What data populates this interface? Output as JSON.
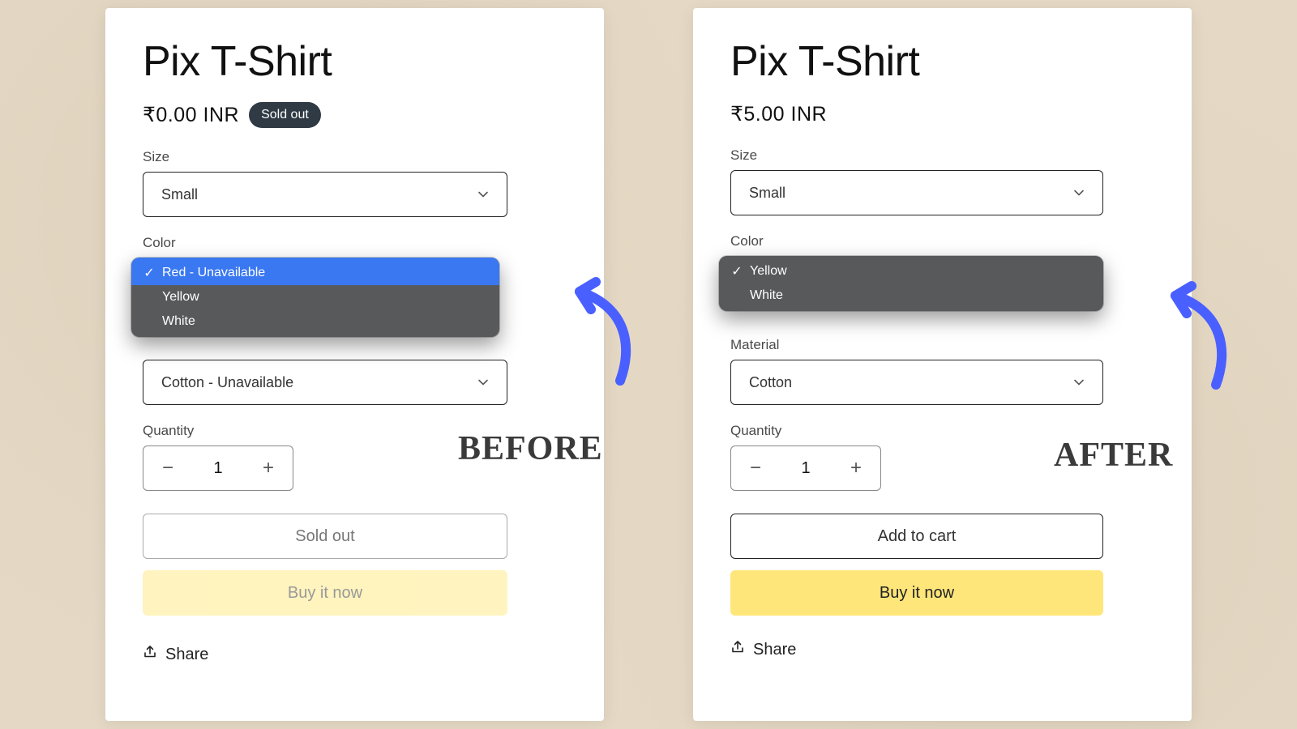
{
  "before": {
    "caption": "BEFORE",
    "title": "Pix T-Shirt",
    "price": "₹0.00 INR",
    "soldout_badge": "Sold out",
    "size_label": "Size",
    "size_value": "Small",
    "color_label": "Color",
    "color_options": {
      "o0": "Red - Unavailable",
      "o1": "Yellow",
      "o2": "White"
    },
    "material_value": "Cotton - Unavailable",
    "quantity_label": "Quantity",
    "quantity_value": "1",
    "soldout_button": "Sold out",
    "buy_button": "Buy it now",
    "share_label": "Share"
  },
  "after": {
    "caption": "AFTER",
    "title": "Pix T-Shirt",
    "price": "₹5.00 INR",
    "size_label": "Size",
    "size_value": "Small",
    "color_label": "Color",
    "color_options": {
      "o0": "Yellow",
      "o1": "White"
    },
    "material_label": "Material",
    "material_value": "Cotton",
    "quantity_label": "Quantity",
    "quantity_value": "1",
    "addcart_button": "Add to cart",
    "buy_button": "Buy it now",
    "share_label": "Share"
  }
}
